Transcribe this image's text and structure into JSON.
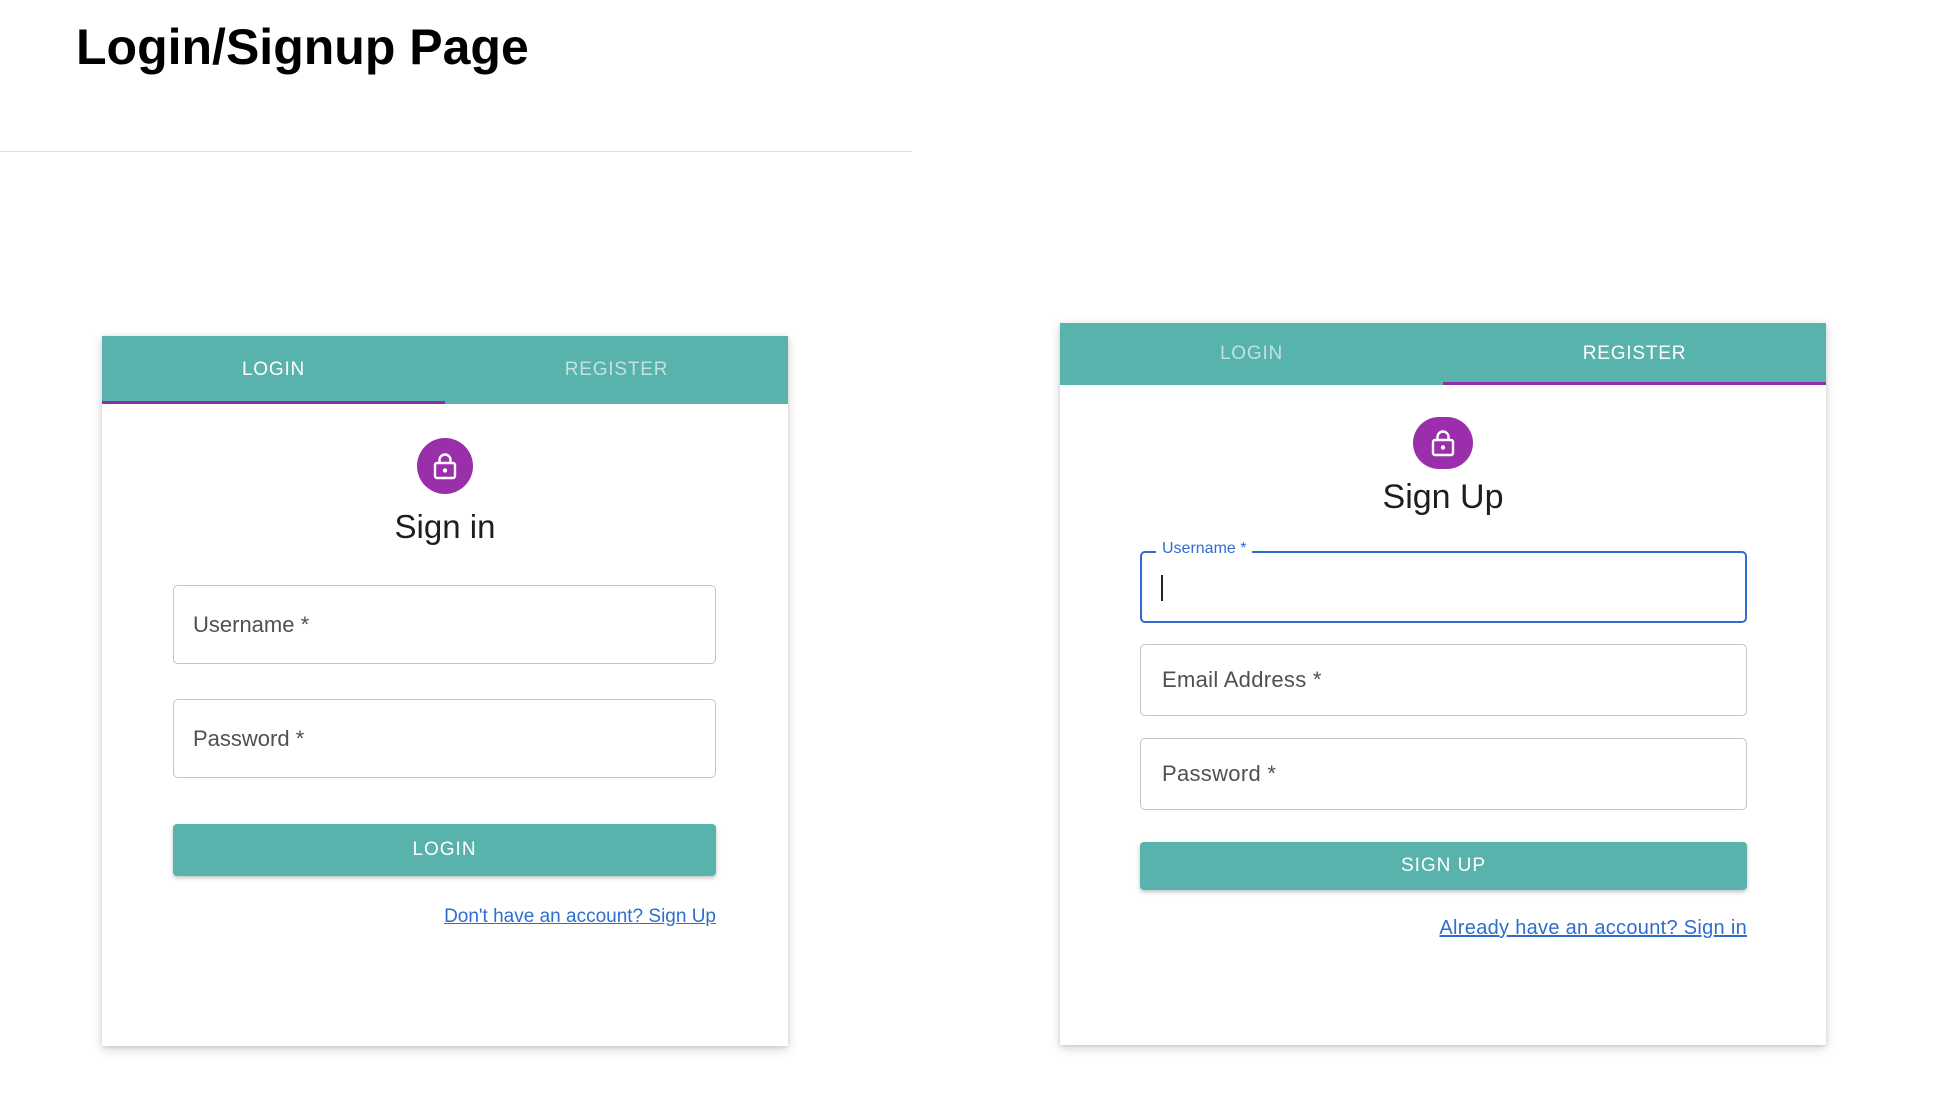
{
  "page": {
    "title": "Login/Signup Page"
  },
  "colors": {
    "tab_bar": "#59b3ad",
    "indicator": "#8e2cab",
    "avatar": "#9b2eaa",
    "focus": "#2f6dd0"
  },
  "login_card": {
    "tabs": [
      {
        "label": "LOGIN",
        "active": true
      },
      {
        "label": "REGISTER",
        "active": false
      }
    ],
    "icon": "lock-icon",
    "heading": "Sign in",
    "fields": {
      "username": "Username *",
      "password": "Password *"
    },
    "submit_label": "LOGIN",
    "switch_link": "Don't have an account? Sign Up"
  },
  "signup_card": {
    "tabs": [
      {
        "label": "LOGIN",
        "active": false
      },
      {
        "label": "REGISTER",
        "active": true
      }
    ],
    "icon": "lock-icon",
    "heading": "Sign Up",
    "fields": {
      "username": "Username *",
      "email": "Email Address *",
      "password": "Password *"
    },
    "submit_label": "SIGN UP",
    "switch_link": "Already have an account? Sign in"
  }
}
